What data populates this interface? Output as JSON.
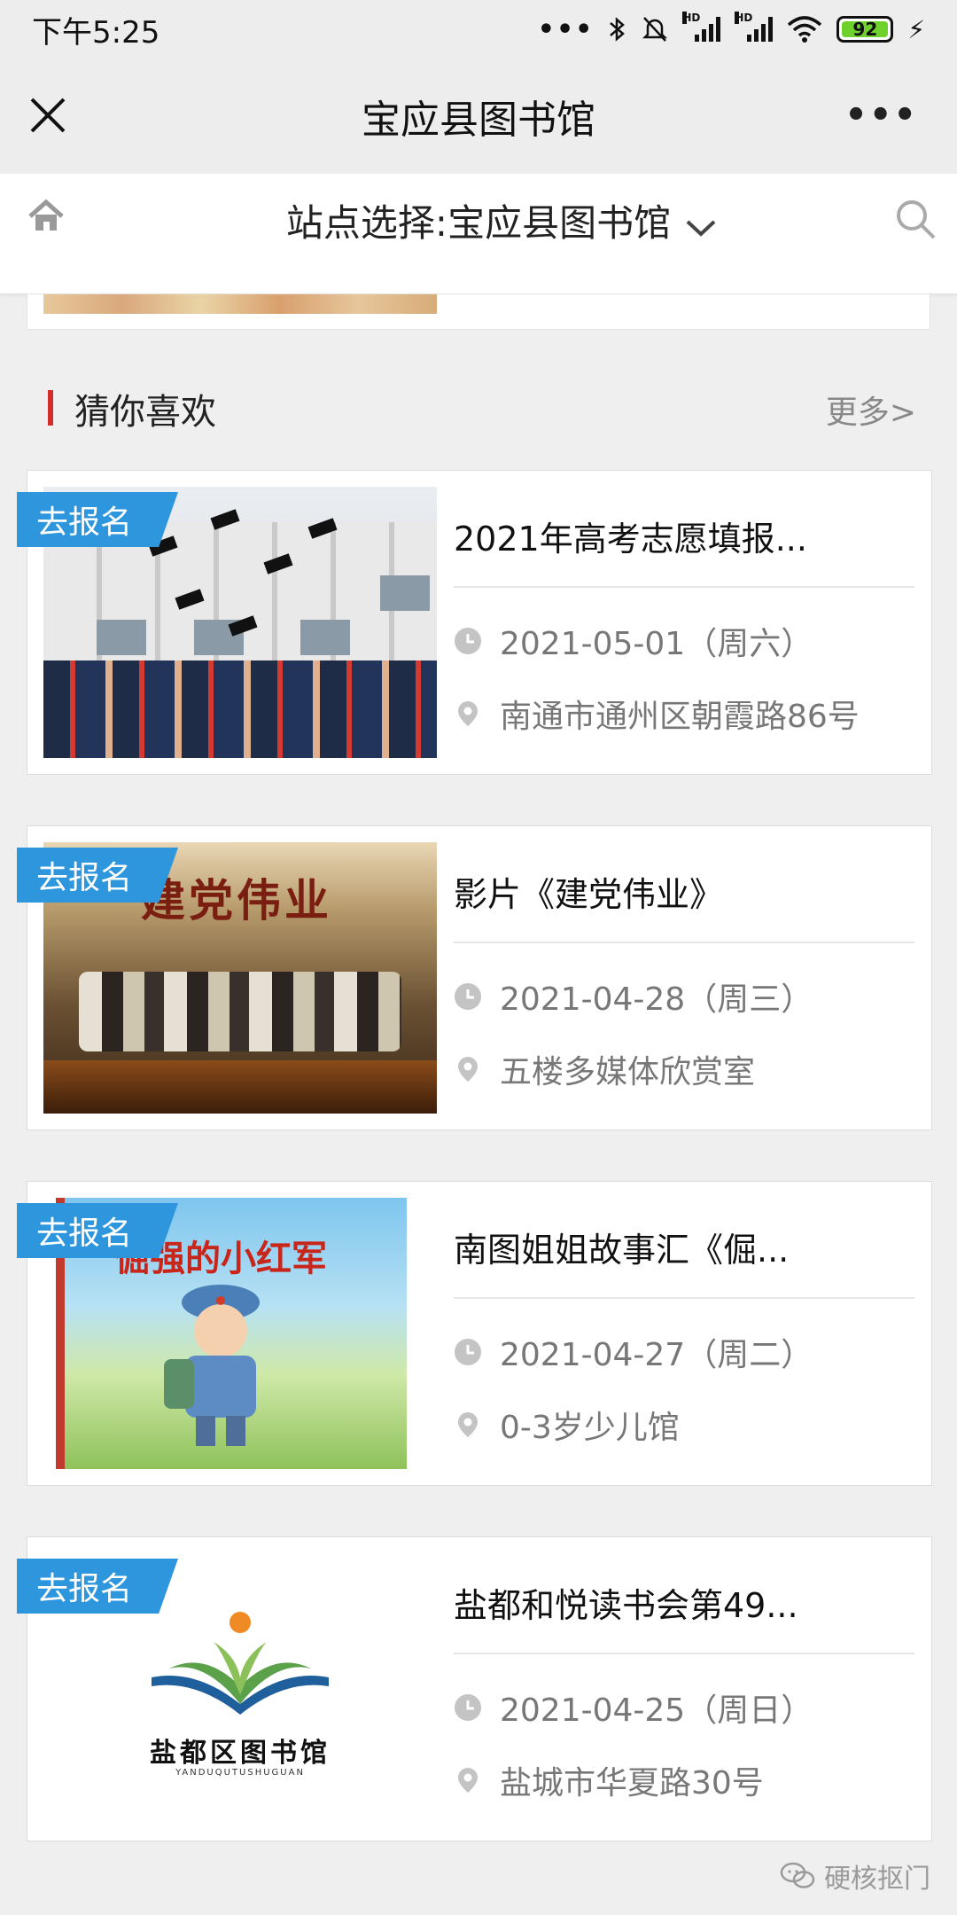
{
  "status_bar": {
    "time": "下午5:25",
    "battery": "92",
    "signal_label": "HD"
  },
  "header": {
    "title": "宝应县图书馆"
  },
  "site_bar": {
    "label": "站点选择:宝应县图书馆"
  },
  "section": {
    "title": "猜你喜欢",
    "more": "更多>"
  },
  "cards": [
    {
      "tag": "去报名",
      "title": "2021年高考志愿填报...",
      "date": "2021-05-01（周六）",
      "location": "南通市通州区朝霞路86号"
    },
    {
      "tag": "去报名",
      "title": "影片《建党伟业》",
      "date": "2021-04-28（周三）",
      "location": "五楼多媒体欣赏室",
      "poster_title": "建党伟业"
    },
    {
      "tag": "去报名",
      "title": "南图姐姐故事汇《倔...",
      "date": "2021-04-27（周二）",
      "location": "0-3岁少儿馆",
      "book_title": "倔强的小红军"
    },
    {
      "tag": "去报名",
      "title": "盐都和悦读书会第49...",
      "date": "2021-04-25（周日）",
      "location": "盐城市华夏路30号",
      "logo_name": "盐都区图书馆",
      "logo_sub": "YANDUQUTUSHUGUAN"
    }
  ],
  "watermark": {
    "text": "硬核抠门"
  },
  "colors": {
    "accent_red": "#d22c2c",
    "tag_blue": "#2d96dd",
    "battery_green": "#6fd12b"
  }
}
